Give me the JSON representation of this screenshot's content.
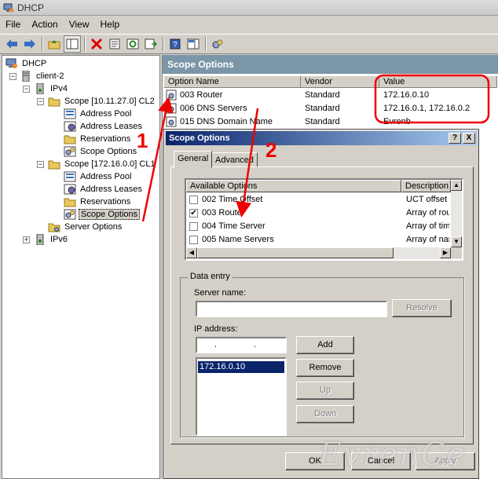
{
  "window": {
    "title": "DHCP"
  },
  "menu": [
    "File",
    "Action",
    "View",
    "Help"
  ],
  "tree": {
    "root": "DHCP",
    "server": "client-2",
    "ipv4": "IPv4",
    "scope1": "Scope [10.11.27.0] CL2",
    "scope2": "Scope [172.16.0.0] CL1",
    "address_pool": "Address Pool",
    "address_leases": "Address Leases",
    "reservations": "Reservations",
    "scope_options": "Scope Options",
    "server_options": "Server Options",
    "ipv6": "IPv6"
  },
  "panel": {
    "title": "Scope Options",
    "columns": [
      "Option Name",
      "Vendor",
      "Value"
    ],
    "rows": [
      {
        "name": "003 Router",
        "vendor": "Standard",
        "value": "172.16.0.10"
      },
      {
        "name": "006 DNS Servers",
        "vendor": "Standard",
        "value": "172.16.0.1, 172.16.0.2"
      },
      {
        "name": "015 DNS Domain Name",
        "vendor": "Standard",
        "value": "Evrenb"
      }
    ]
  },
  "dialog": {
    "title": "Scope Options",
    "help_btn": "?",
    "close_btn": "X",
    "tabs": [
      "General",
      "Advanced"
    ],
    "options_header": [
      "Available Options",
      "Description"
    ],
    "options": [
      {
        "name": "002 Time Offset",
        "desc": "UCT offset in",
        "checked": false
      },
      {
        "name": "003 Router",
        "desc": "Array of router",
        "checked": true
      },
      {
        "name": "004 Time Server",
        "desc": "Array of time",
        "checked": false
      },
      {
        "name": "005 Name Servers",
        "desc": "Array of name",
        "checked": false
      }
    ],
    "data_entry_label": "Data entry",
    "server_name_label": "Server name:",
    "resolve_btn": "Resolve",
    "ip_label": "IP address:",
    "ip_placeholder": ". . .",
    "add_btn": "Add",
    "remove_btn": "Remove",
    "up_btn": "Up",
    "down_btn": "Down",
    "ip_list": [
      "172.16.0.10"
    ],
    "ok_btn": "OK",
    "cancel_btn": "Cancel",
    "apply_btn": "Apply"
  },
  "annotations": {
    "arrow1": "1",
    "arrow2": "2"
  },
  "watermark": "EvrenCe",
  "colors": {
    "annotation": "#e00000",
    "dialog_title": "#0a246a",
    "panel_header": "#7a96a8"
  }
}
